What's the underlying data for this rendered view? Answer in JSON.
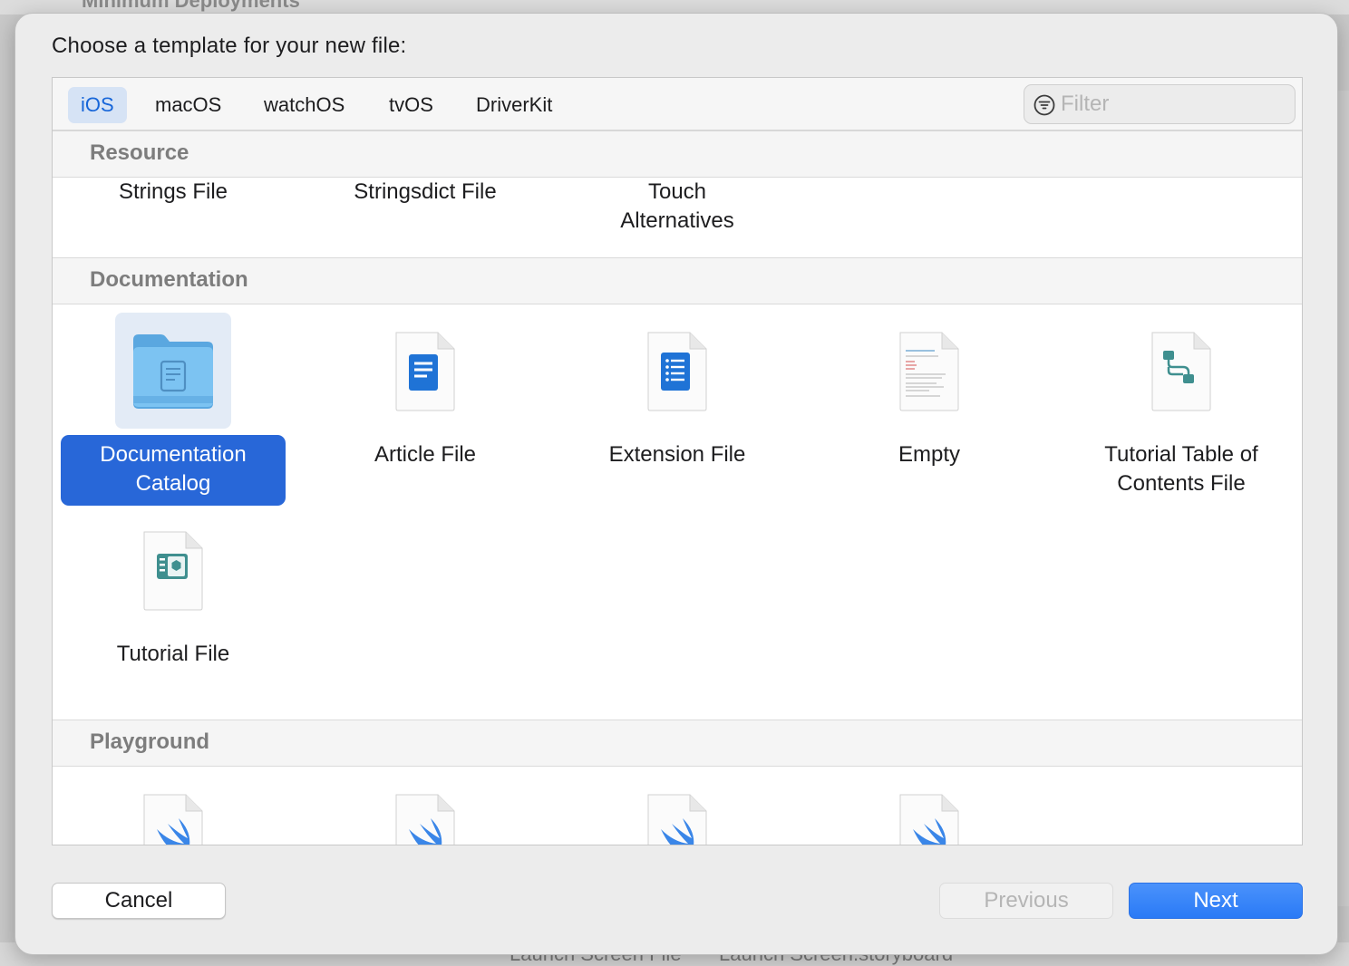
{
  "background": {
    "top_text": "Minimum Deployments",
    "bottom_left_text": "Launch Screen File",
    "bottom_right_text": "Launch Screen.storyboard"
  },
  "dialog": {
    "title": "Choose a template for your new file:"
  },
  "tabs": [
    {
      "label": "iOS",
      "selected": true
    },
    {
      "label": "macOS",
      "selected": false
    },
    {
      "label": "watchOS",
      "selected": false
    },
    {
      "label": "tvOS",
      "selected": false
    },
    {
      "label": "DriverKit",
      "selected": false
    }
  ],
  "filter": {
    "placeholder": "Filter",
    "icon": "filter-icon"
  },
  "sections": {
    "resource": {
      "title": "Resource",
      "items": [
        {
          "label": "Strings File"
        },
        {
          "label": "Stringsdict File"
        },
        {
          "label": "Touch Alternatives"
        }
      ]
    },
    "documentation": {
      "title": "Documentation",
      "items": [
        {
          "label": "Documentation Catalog",
          "icon": "folder-icon",
          "selected": true
        },
        {
          "label": "Article File",
          "icon": "article-file-icon"
        },
        {
          "label": "Extension File",
          "icon": "extension-file-icon"
        },
        {
          "label": "Empty",
          "icon": "empty-file-icon"
        },
        {
          "label": "Tutorial Table of Contents File",
          "icon": "tutorial-toc-file-icon"
        },
        {
          "label": "Tutorial File",
          "icon": "tutorial-file-icon"
        }
      ]
    },
    "playground": {
      "title": "Playground",
      "items": [
        {
          "icon": "swift-file-icon"
        },
        {
          "icon": "swift-file-icon"
        },
        {
          "icon": "swift-file-icon"
        },
        {
          "icon": "swift-file-icon"
        }
      ]
    }
  },
  "buttons": {
    "cancel": "Cancel",
    "previous": "Previous",
    "next": "Next"
  },
  "colors": {
    "accent": "#2867d8",
    "next_button": "#2a7af6",
    "selected_tab_bg": "#d6e3f5",
    "folder": "#6cb6ea"
  }
}
